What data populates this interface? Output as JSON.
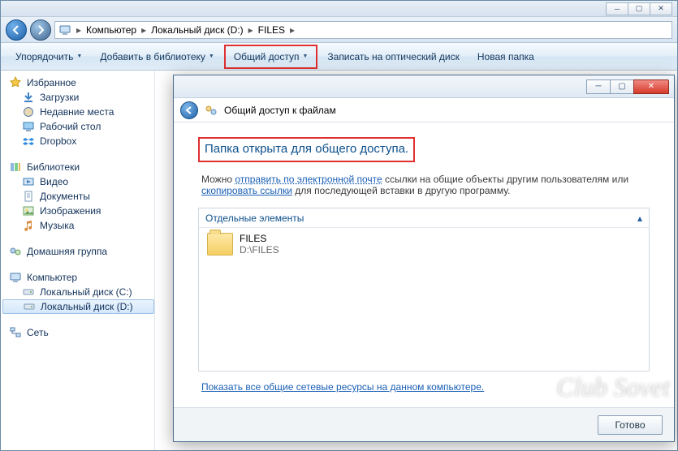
{
  "breadcrumb": {
    "items": [
      "Компьютер",
      "Локальный диск (D:)",
      "FILES"
    ]
  },
  "toolbar": {
    "organize": "Упорядочить",
    "add_library": "Добавить в библиотеку",
    "share": "Общий доступ",
    "burn": "Записать на оптический диск",
    "new_folder": "Новая папка"
  },
  "tree": {
    "favorites": {
      "label": "Избранное",
      "items": [
        "Загрузки",
        "Недавние места",
        "Рабочий стол",
        "Dropbox"
      ]
    },
    "libraries": {
      "label": "Библиотеки",
      "items": [
        "Видео",
        "Документы",
        "Изображения",
        "Музыка"
      ]
    },
    "homegroup": {
      "label": "Домашняя группа"
    },
    "computer": {
      "label": "Компьютер",
      "items": [
        "Локальный диск (C:)",
        "Локальный диск (D:)"
      ]
    },
    "network": {
      "label": "Сеть"
    }
  },
  "dialog": {
    "title": "Общий доступ к файлам",
    "headline": "Папка открыта для общего доступа.",
    "para_prefix": "Можно ",
    "link_email": "отправить по электронной почте",
    "para_mid": " ссылки на общие объекты другим пользователям или ",
    "link_copy": "скопировать ссылки",
    "para_suffix": " для последующей вставки в другую программу.",
    "group_label": "Отдельные элементы",
    "file_name": "FILES",
    "file_path": "D:\\FILES",
    "net_link": "Показать все общие сетевые ресурсы на данном компьютере.",
    "done": "Готово"
  },
  "watermark": "Club Sovet"
}
